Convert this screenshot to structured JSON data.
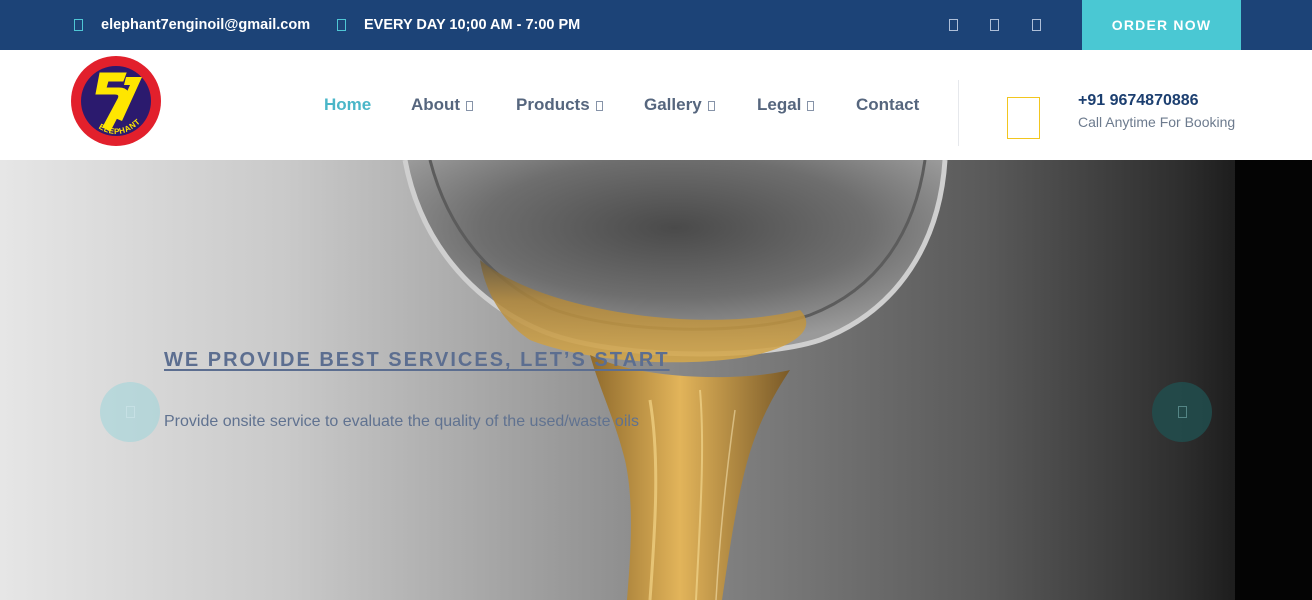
{
  "topbar": {
    "email": "elephant7enginoil@gmail.com",
    "email_icon": "envelope-icon",
    "hours": "EVERY DAY 10;00 AM - 7:00 PM",
    "hours_icon": "clock-icon",
    "social_icons": [
      "facebook-icon",
      "twitter-icon",
      "instagram-icon"
    ],
    "order_label": "ORDER NOW"
  },
  "logo": {
    "text": "ELEPHANT-7"
  },
  "nav": {
    "items": [
      {
        "label": "Home",
        "active": true,
        "dropdown": false
      },
      {
        "label": "About",
        "active": false,
        "dropdown": true
      },
      {
        "label": "Products",
        "active": false,
        "dropdown": true
      },
      {
        "label": "Gallery",
        "active": false,
        "dropdown": true
      },
      {
        "label": "Legal",
        "active": false,
        "dropdown": true
      },
      {
        "label": "Contact",
        "active": false,
        "dropdown": false
      }
    ]
  },
  "contact": {
    "phone_icon": "phone-icon",
    "phone": "+91 9674870886",
    "subtitle": "Call Anytime For Booking"
  },
  "hero": {
    "title": "WE PROVIDE BEST SERVICES, LET’S START",
    "text": "Provide onsite service to evaluate the quality of the used/waste oils",
    "prev_icon": "chevron-left-icon",
    "next_icon": "chevron-right-icon"
  },
  "colors": {
    "topbar_bg": "#1c4377",
    "accent": "#4ac8d3",
    "nav_active": "#4ab6c8",
    "nav_text": "#56667e",
    "phone_text": "#1c3f70",
    "phone_icon": "#f2c61f"
  }
}
